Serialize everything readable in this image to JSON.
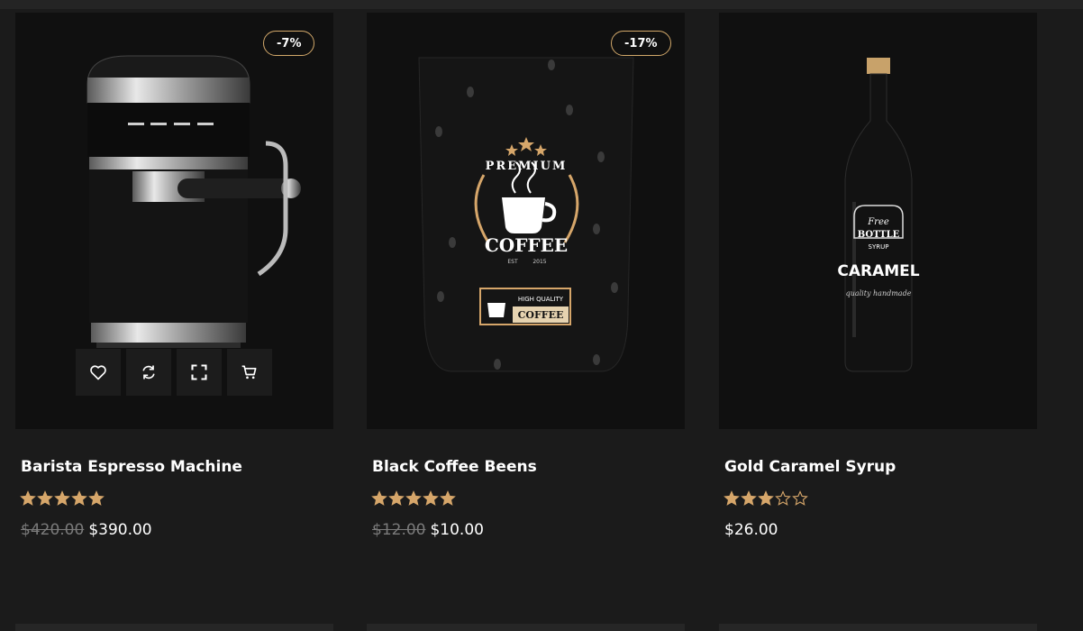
{
  "products": [
    {
      "name": "Barista Espresso Machine",
      "badge": "-7%",
      "rating": 5,
      "old_price": "$420.00",
      "price": "$390.00"
    },
    {
      "name": "Black Coffee Beens",
      "badge": "-17%",
      "rating": 5,
      "old_price": "$12.00",
      "price": "$10.00",
      "package": {
        "arc_text": "PREMIUM",
        "brand": "COFFEE",
        "est": "EST",
        "year": "2015",
        "label_top": "HIGH QUALITY",
        "label_bottom": "COFFEE"
      }
    },
    {
      "name": "Gold Caramel Syrup",
      "rating": 3,
      "price": "$26.00",
      "label": {
        "line1": "Free",
        "line2": "BOTTLE",
        "line3": "SYRUP",
        "main": "CARAMEL",
        "sub": "quality handmade"
      }
    }
  ],
  "actions": [
    "heart-icon",
    "compare-icon",
    "quick-view-icon",
    "cart-icon"
  ],
  "colors": {
    "background": "#1b1b1b",
    "card": "#101010",
    "accent": "#d2a86a",
    "star": "#d6a66a"
  }
}
